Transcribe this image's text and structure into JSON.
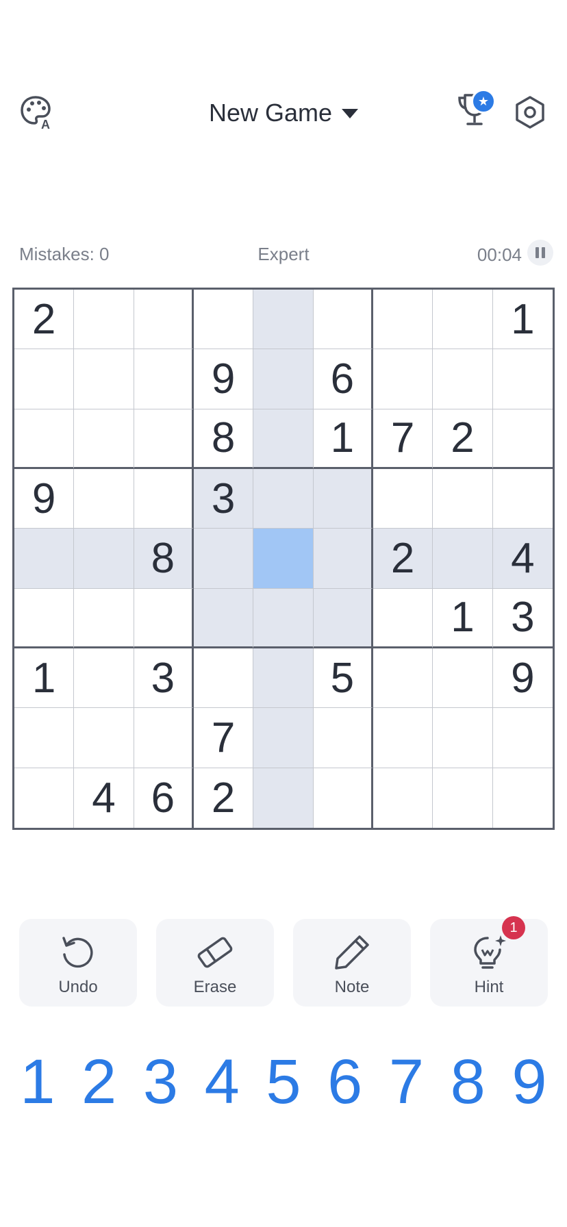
{
  "header": {
    "title": "New Game",
    "theme_icon": "palette-icon",
    "trophy_icon": "trophy-icon",
    "trophy_badge_icon": "star-icon",
    "settings_icon": "hexagon-gear-icon"
  },
  "info": {
    "mistakes": "Mistakes: 0",
    "difficulty": "Expert",
    "timer": "00:04"
  },
  "board": {
    "rows": [
      [
        "2",
        "",
        "",
        "",
        "",
        "",
        "",
        "",
        "1"
      ],
      [
        "",
        "",
        "",
        "9",
        "",
        "6",
        "",
        "",
        ""
      ],
      [
        "",
        "",
        "",
        "8",
        "",
        "1",
        "7",
        "2",
        ""
      ],
      [
        "9",
        "",
        "",
        "3",
        "",
        "",
        "",
        "",
        ""
      ],
      [
        "",
        "",
        "8",
        "",
        "",
        "",
        "2",
        "",
        "4"
      ],
      [
        "",
        "",
        "",
        "",
        "",
        "",
        "",
        "1",
        "3"
      ],
      [
        "1",
        "",
        "3",
        "",
        "",
        "5",
        "",
        "",
        "9"
      ],
      [
        "",
        "",
        "",
        "7",
        "",
        "",
        "",
        "",
        ""
      ],
      [
        "",
        "4",
        "6",
        "2",
        "",
        "",
        "",
        "",
        ""
      ]
    ],
    "selected": {
      "row": 4,
      "col": 4
    }
  },
  "tools": [
    {
      "label": "Undo",
      "icon": "undo-icon"
    },
    {
      "label": "Erase",
      "icon": "eraser-icon"
    },
    {
      "label": "Note",
      "icon": "pencil-icon"
    },
    {
      "label": "Hint",
      "icon": "lightbulb-icon",
      "badge": "1"
    }
  ],
  "numpad": [
    "1",
    "2",
    "3",
    "4",
    "5",
    "6",
    "7",
    "8",
    "9"
  ],
  "colors": {
    "accent": "#2c7be5",
    "selected_cell": "#a1c6f5",
    "highlight_cell": "#e2e6ef",
    "hint_badge": "#d6334f"
  }
}
